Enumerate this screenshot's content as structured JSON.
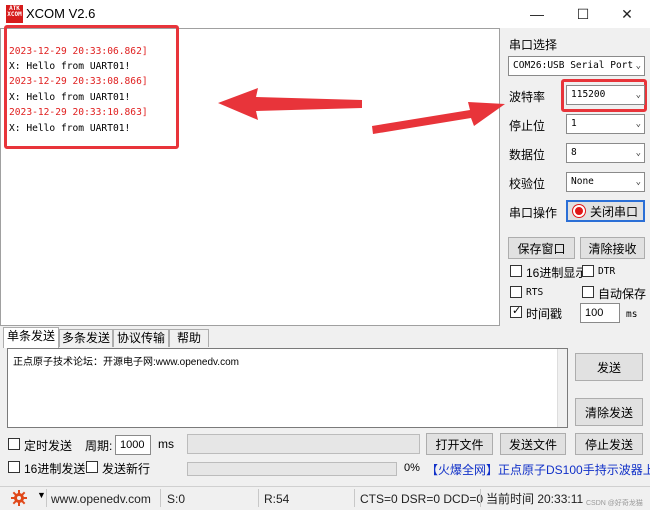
{
  "window": {
    "logo_text": "ATK",
    "logo_text2": "XCOM",
    "title": "XCOM V2.6",
    "minimize": "—",
    "maximize": "☐",
    "close": "✕"
  },
  "receive": {
    "lines": [
      {
        "text": "2023-12-29 20:33:06.862]",
        "color": "red"
      },
      {
        "text": "X: Hello from UART01!",
        "color": "black"
      },
      {
        "text": "2023-12-29 20:33:08.866]",
        "color": "red"
      },
      {
        "text": "X: Hello from UART01!",
        "color": "black"
      },
      {
        "text": "2023-12-29 20:33:10.863]",
        "color": "red"
      },
      {
        "text": "X: Hello from UART01!",
        "color": "black"
      }
    ]
  },
  "settings": {
    "port_label": "串口选择",
    "port_value": "COM26:USB Serial Port",
    "baud_label": "波特率",
    "baud_value": "115200",
    "stop_label": "停止位",
    "stop_value": "1",
    "data_label": "数据位",
    "data_value": "8",
    "parity_label": "校验位",
    "parity_value": "None",
    "op_label": "串口操作",
    "op_button": "关闭串口",
    "save_window": "保存窗口",
    "clear_recv": "清除接收",
    "hex_display": "16进制显示",
    "dtr": "DTR",
    "rts": "RTS",
    "auto_save": "自动保存",
    "timestamp": "时间戳",
    "timestamp_value": "100",
    "timestamp_unit": "ms"
  },
  "tabs": [
    {
      "label": "单条发送",
      "active": true
    },
    {
      "label": "多条发送",
      "active": false
    },
    {
      "label": "协议传输",
      "active": false
    },
    {
      "label": "帮助",
      "active": false
    }
  ],
  "send": {
    "text": "正点原子技术论坛：开源电子网:www.openedv.com",
    "send_button": "发送",
    "clear_send": "清除发送",
    "timed_send": "定时发送",
    "period_label": "周期:",
    "period_value": "1000",
    "period_unit": "ms",
    "open_file": "打开文件",
    "send_file": "发送文件",
    "stop_send": "停止发送",
    "hex_send": "16进制发送",
    "newline": "发送新行",
    "progress_label": "0%",
    "ad_text": "【火爆全网】正点原子DS100手持示波器上市"
  },
  "status": {
    "url": "www.openedv.com",
    "sent": "S:0",
    "received": "R:54",
    "lines": "CTS=0 DSR=0 DCD=0",
    "time": "当前时间 20:33:11",
    "watermark": "CSDN @好奇龙猫"
  },
  "colors": {
    "annotation": "#e8343a",
    "timestamp_text": "#e02020",
    "ad_text": "#1030c8",
    "logo": "#d61c1c"
  }
}
